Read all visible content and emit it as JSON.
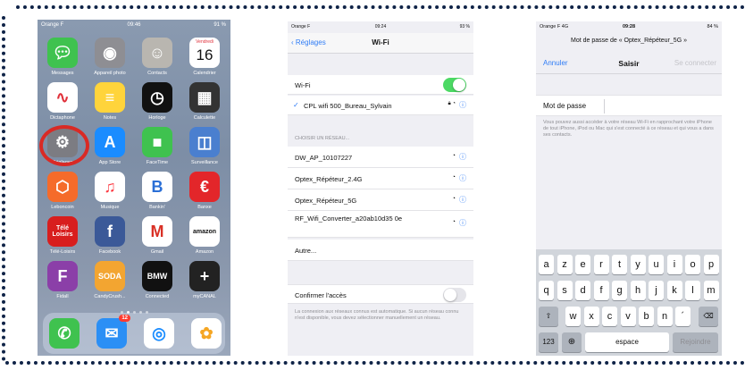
{
  "phone1": {
    "status": {
      "carrier": "Orange F",
      "time": "09:46",
      "battery": "91 %"
    },
    "apps": [
      {
        "label": "Messages",
        "icon": "messages-icon",
        "color": "#3fc24f"
      },
      {
        "label": "Appareil photo",
        "icon": "camera-icon",
        "color": "#8e8e93"
      },
      {
        "label": "Contacts",
        "icon": "contacts-icon",
        "color": "#b9b6b0"
      },
      {
        "label": "Calendrier",
        "icon": "calendar-icon",
        "color": "#ffffff",
        "day": "Vendredi",
        "date": "16"
      },
      {
        "label": "Dictaphone",
        "icon": "voice-memo-icon",
        "color": "#ffffff"
      },
      {
        "label": "Notes",
        "icon": "notes-icon",
        "color": "#ffd43b"
      },
      {
        "label": "Horloge",
        "icon": "clock-icon",
        "color": "#111111"
      },
      {
        "label": "Calculette",
        "icon": "calculator-icon",
        "color": "#333333"
      },
      {
        "label": "Réglages",
        "icon": "settings-icon",
        "color": "#7c7c82"
      },
      {
        "label": "App Store",
        "icon": "app-store-icon",
        "color": "#1a8cff"
      },
      {
        "label": "FaceTime",
        "icon": "facetime-icon",
        "color": "#3fc24f"
      },
      {
        "label": "Surveillance",
        "icon": "surveillance-icon",
        "color": "#4a7fcf"
      },
      {
        "label": "Leboncoin",
        "icon": "leboncoin-icon",
        "color": "#f56b2a"
      },
      {
        "label": "Musique",
        "icon": "music-icon",
        "color": "#ffffff"
      },
      {
        "label": "Bankin'",
        "icon": "bankin-icon",
        "color": "#ffffff"
      },
      {
        "label": "Banxe",
        "icon": "banxe-icon",
        "color": "#e3262a"
      },
      {
        "label": "Télé-Loisirs",
        "icon": "tele-loisirs-icon",
        "color": "#d81e1e",
        "text": "Télé Loisirs"
      },
      {
        "label": "Facebook",
        "icon": "facebook-icon",
        "color": "#3b5998"
      },
      {
        "label": "Gmail",
        "icon": "gmail-icon",
        "color": "#ffffff"
      },
      {
        "label": "Amazon",
        "icon": "amazon-icon",
        "color": "#ffffff",
        "text": "amazon"
      },
      {
        "label": "Fidall",
        "icon": "fidall-icon",
        "color": "#8b3fa8"
      },
      {
        "label": "CandyCrush...",
        "icon": "candy-crush-icon",
        "color": "#f3a531",
        "text": "SODA"
      },
      {
        "label": "Connected",
        "icon": "bmw-connected-icon",
        "color": "#111111",
        "text": "BMW"
      },
      {
        "label": "myCANAL",
        "icon": "mycanal-icon",
        "color": "#222222"
      }
    ],
    "dock": [
      {
        "icon": "phone-icon",
        "color": "#3fc24f"
      },
      {
        "icon": "mail-icon",
        "color": "#2b8ff5",
        "badge": "12"
      },
      {
        "icon": "safari-icon",
        "color": "#ffffff"
      },
      {
        "icon": "photos-icon",
        "color": "#ffffff"
      }
    ]
  },
  "phone2": {
    "status": {
      "carrier": "Orange F",
      "time": "09:24",
      "battery": "93 %"
    },
    "back_label": "Réglages",
    "title": "Wi-Fi",
    "wifi_label": "Wi-Fi",
    "wifi_on": true,
    "connected_network": "CPL wifi 500_Bureau_Sylvain",
    "section_header": "CHOISIR UN RÉSEAU...",
    "networks": [
      "DW_AP_10107227",
      "Optex_Répéteur_2.4G",
      "Optex_Répéteur_5G",
      "RF_Wifi_Converter_a20ab10d35 0e"
    ],
    "other_label": "Autre...",
    "ask_join_label": "Confirmer l'accès",
    "ask_join_on": false,
    "footer": "La connexion aux réseaux connus est automatique. Si aucun réseau connu n'est disponible, vous devez sélectionner manuellement un réseau.",
    "accent_color": "#2f7cf6",
    "toggle_on_color": "#4cd964"
  },
  "phone3": {
    "status": {
      "carrier": "Orange F  4G",
      "time": "09:28",
      "battery": "84 %"
    },
    "prompt": "Mot de passe de « Optex_Répéteur_5G »",
    "cancel_label": "Annuler",
    "title": "Saisir",
    "connect_label": "Se connecter",
    "password_label": "Mot de passe",
    "password_value": "",
    "help_text": "Vous pouvez aussi accéder à votre réseau Wi-Fi en rapprochant votre iPhone de tout iPhone, iPod ou Mac qui s'est connecté à ce réseau et qui vous a dans ses contacts.",
    "keyboard": {
      "row1": [
        "a",
        "z",
        "e",
        "r",
        "t",
        "y",
        "u",
        "i",
        "o",
        "p"
      ],
      "row2": [
        "q",
        "s",
        "d",
        "f",
        "g",
        "h",
        "j",
        "k",
        "l",
        "m"
      ],
      "row3": [
        "w",
        "x",
        "c",
        "v",
        "b",
        "n",
        "´"
      ],
      "numbers_key": "123",
      "space_key": "espace",
      "join_key": "Rejoindre"
    }
  }
}
